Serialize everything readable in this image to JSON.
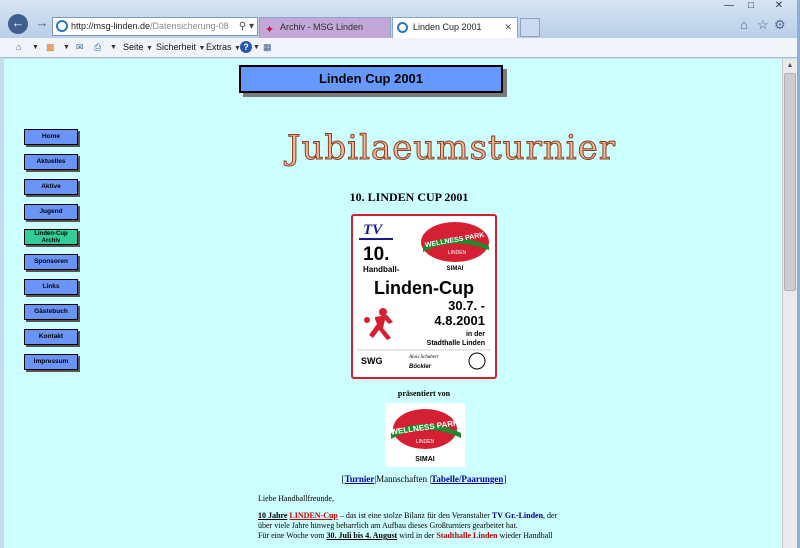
{
  "browser": {
    "address_host": "http://msg-linden.de",
    "address_path": "/Datensicherung-08",
    "tabs": [
      {
        "label": "Archiv - MSG Linden"
      },
      {
        "label": "Linden Cup 2001"
      }
    ],
    "toolbar": {
      "page_label": "Seite",
      "security_label": "Sicherheit",
      "extras_label": "Extras"
    }
  },
  "page": {
    "header": "Linden Cup 2001",
    "headline_art": "Jubilaeumsturnier",
    "title": "10. LINDEN CUP 2001",
    "sidebar": [
      {
        "label": "Home"
      },
      {
        "label": "Aktuelles"
      },
      {
        "label": "Aktive"
      },
      {
        "label": "Jugend"
      },
      {
        "label_line1": "Linden-Cup",
        "label_line2": "Archiv"
      },
      {
        "label": "Sponsoren"
      },
      {
        "label": "Links"
      },
      {
        "label": "Gästebuch"
      },
      {
        "label": "Kontakt"
      },
      {
        "label": "Impressum"
      }
    ],
    "poster": {
      "tv_logo": "TV",
      "number": "10.",
      "sponsor_line1": "WELLNESS PARK",
      "sponsor_line2": "LINDEN",
      "sponsor_line3": "SIMAI",
      "handball": "Handball-",
      "cup": "Linden-Cup",
      "date1": "30.7. -",
      "date2": "4.8.2001",
      "loc1": "in der",
      "loc2": "Stadthalle Linden",
      "bottom_left": "SWG",
      "bottom_mid1": "Alois Schubert",
      "bottom_mid2": "Böckler"
    },
    "praesentiert": "präsentiert von",
    "sponsor": {
      "line1": "WELLNESS PARK",
      "line2": "LINDEN",
      "line3": "SIMAI"
    },
    "nav": {
      "turnier": "Turnier",
      "mannschaften": "Mannschaften",
      "tabelle": "Tabelle/Paarungen"
    },
    "greeting": "Liebe Handballfreunde,",
    "text": {
      "l1_a": "10 Jahre",
      "l1_b": "LINDEN-Cup",
      "l1_c": "– das ist eine stolze Bilanz für den Veranstalter",
      "l1_d": "TV Gr.-Linden",
      "l1_e": ", der",
      "l2": "über viele Jahre hinweg beharrlich am Aufbau dieses Großturniers gearbeitet hat.",
      "l3_a": "Für eine Woche vom",
      "l3_b": "30. Juli bis 4. August",
      "l3_c": "wird in der",
      "l3_d": "Stadthalle Linden",
      "l3_e": "wieder Handball"
    }
  },
  "colors": {
    "page_bg": "#ccffff",
    "header_bg": "#6699ff",
    "nav_button": "#6a94f7",
    "nav_button_active": "#33cc99",
    "poster_red": "#d52033"
  }
}
